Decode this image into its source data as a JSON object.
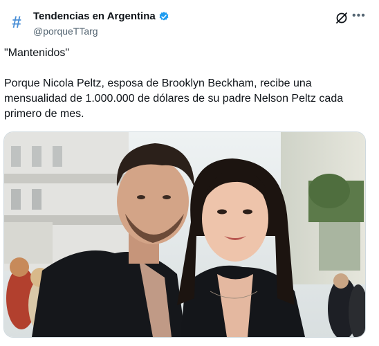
{
  "account": {
    "display_name": "Tendencias en Argentina",
    "handle": "@porqueTTarg",
    "avatar_glyph": "#",
    "verified_color": "#1d9bf0"
  },
  "tweet": {
    "line1": "\"Mantenidos\"",
    "body": "Porque Nicola Peltz, esposa de Brooklyn Beckham, recibe una mensualidad de 1.000.000 de dólares de su padre Nelson Peltz cada primero de mes."
  },
  "actions": {
    "more_label": "•••",
    "grok_icon": "grok-icon"
  },
  "colors": {
    "text": "#0f1419",
    "secondary": "#536471",
    "border": "#cfd9de"
  }
}
